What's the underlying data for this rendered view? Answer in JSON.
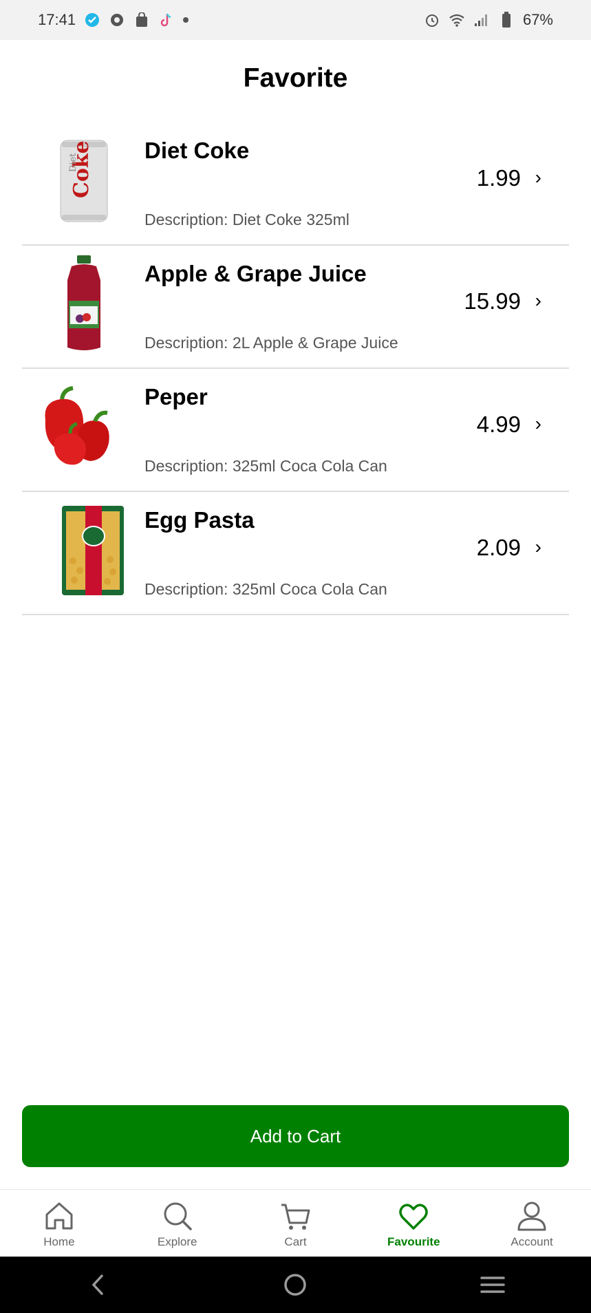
{
  "status": {
    "time": "17:41",
    "battery": "67%",
    "icons": [
      "check-badge-icon",
      "recycle-icon",
      "shop-bag-icon",
      "tiktok-icon",
      "dot-icon",
      "alarm-icon",
      "wifi-icon",
      "signal-icon",
      "battery-icon"
    ]
  },
  "page": {
    "title": "Favorite"
  },
  "items": [
    {
      "name": "Diet Coke",
      "description": "Description: Diet Coke 325ml",
      "price": "1.99",
      "image": "diet-coke-can"
    },
    {
      "name": "Apple & Grape Juice",
      "description": "Description: 2L Apple & Grape Juice",
      "price": "15.99",
      "image": "juice-bottle"
    },
    {
      "name": "Peper",
      "description": "Description: 325ml Coca Cola Can",
      "price": "4.99",
      "image": "red-peppers"
    },
    {
      "name": "Egg Pasta",
      "description": "Description: 325ml Coca Cola Can",
      "price": "2.09",
      "image": "pasta-bag"
    }
  ],
  "actions": {
    "add_to_cart": "Add to Cart"
  },
  "tabs": [
    {
      "label": "Home",
      "icon": "home-icon",
      "active": false
    },
    {
      "label": "Explore",
      "icon": "search-icon",
      "active": false
    },
    {
      "label": "Cart",
      "icon": "cart-icon",
      "active": false
    },
    {
      "label": "Favourite",
      "icon": "heart-icon",
      "active": true
    },
    {
      "label": "Account",
      "icon": "account-icon",
      "active": false
    }
  ],
  "colors": {
    "accent": "#008000",
    "divider": "#dedede",
    "muted": "#666666"
  }
}
